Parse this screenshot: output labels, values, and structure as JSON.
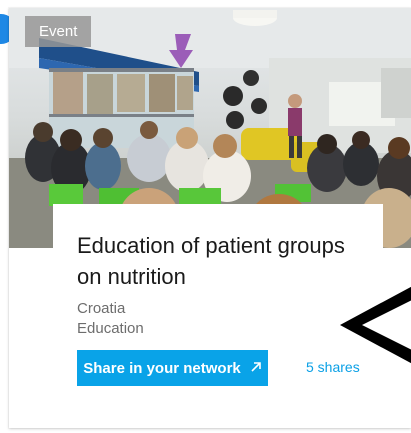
{
  "card": {
    "tag": "Event",
    "title": "Education of patient groups on nutrition",
    "country": "Croatia",
    "category": "Education",
    "share_button_label": "Share in your network",
    "share_icon": "arrow-up-right-icon",
    "shares_count_label": "5 shares"
  },
  "colors": {
    "accent": "#09a3e8",
    "link": "#0aa0e6",
    "tag_bg": "#969696",
    "edge_dot": "#1e88e5"
  }
}
